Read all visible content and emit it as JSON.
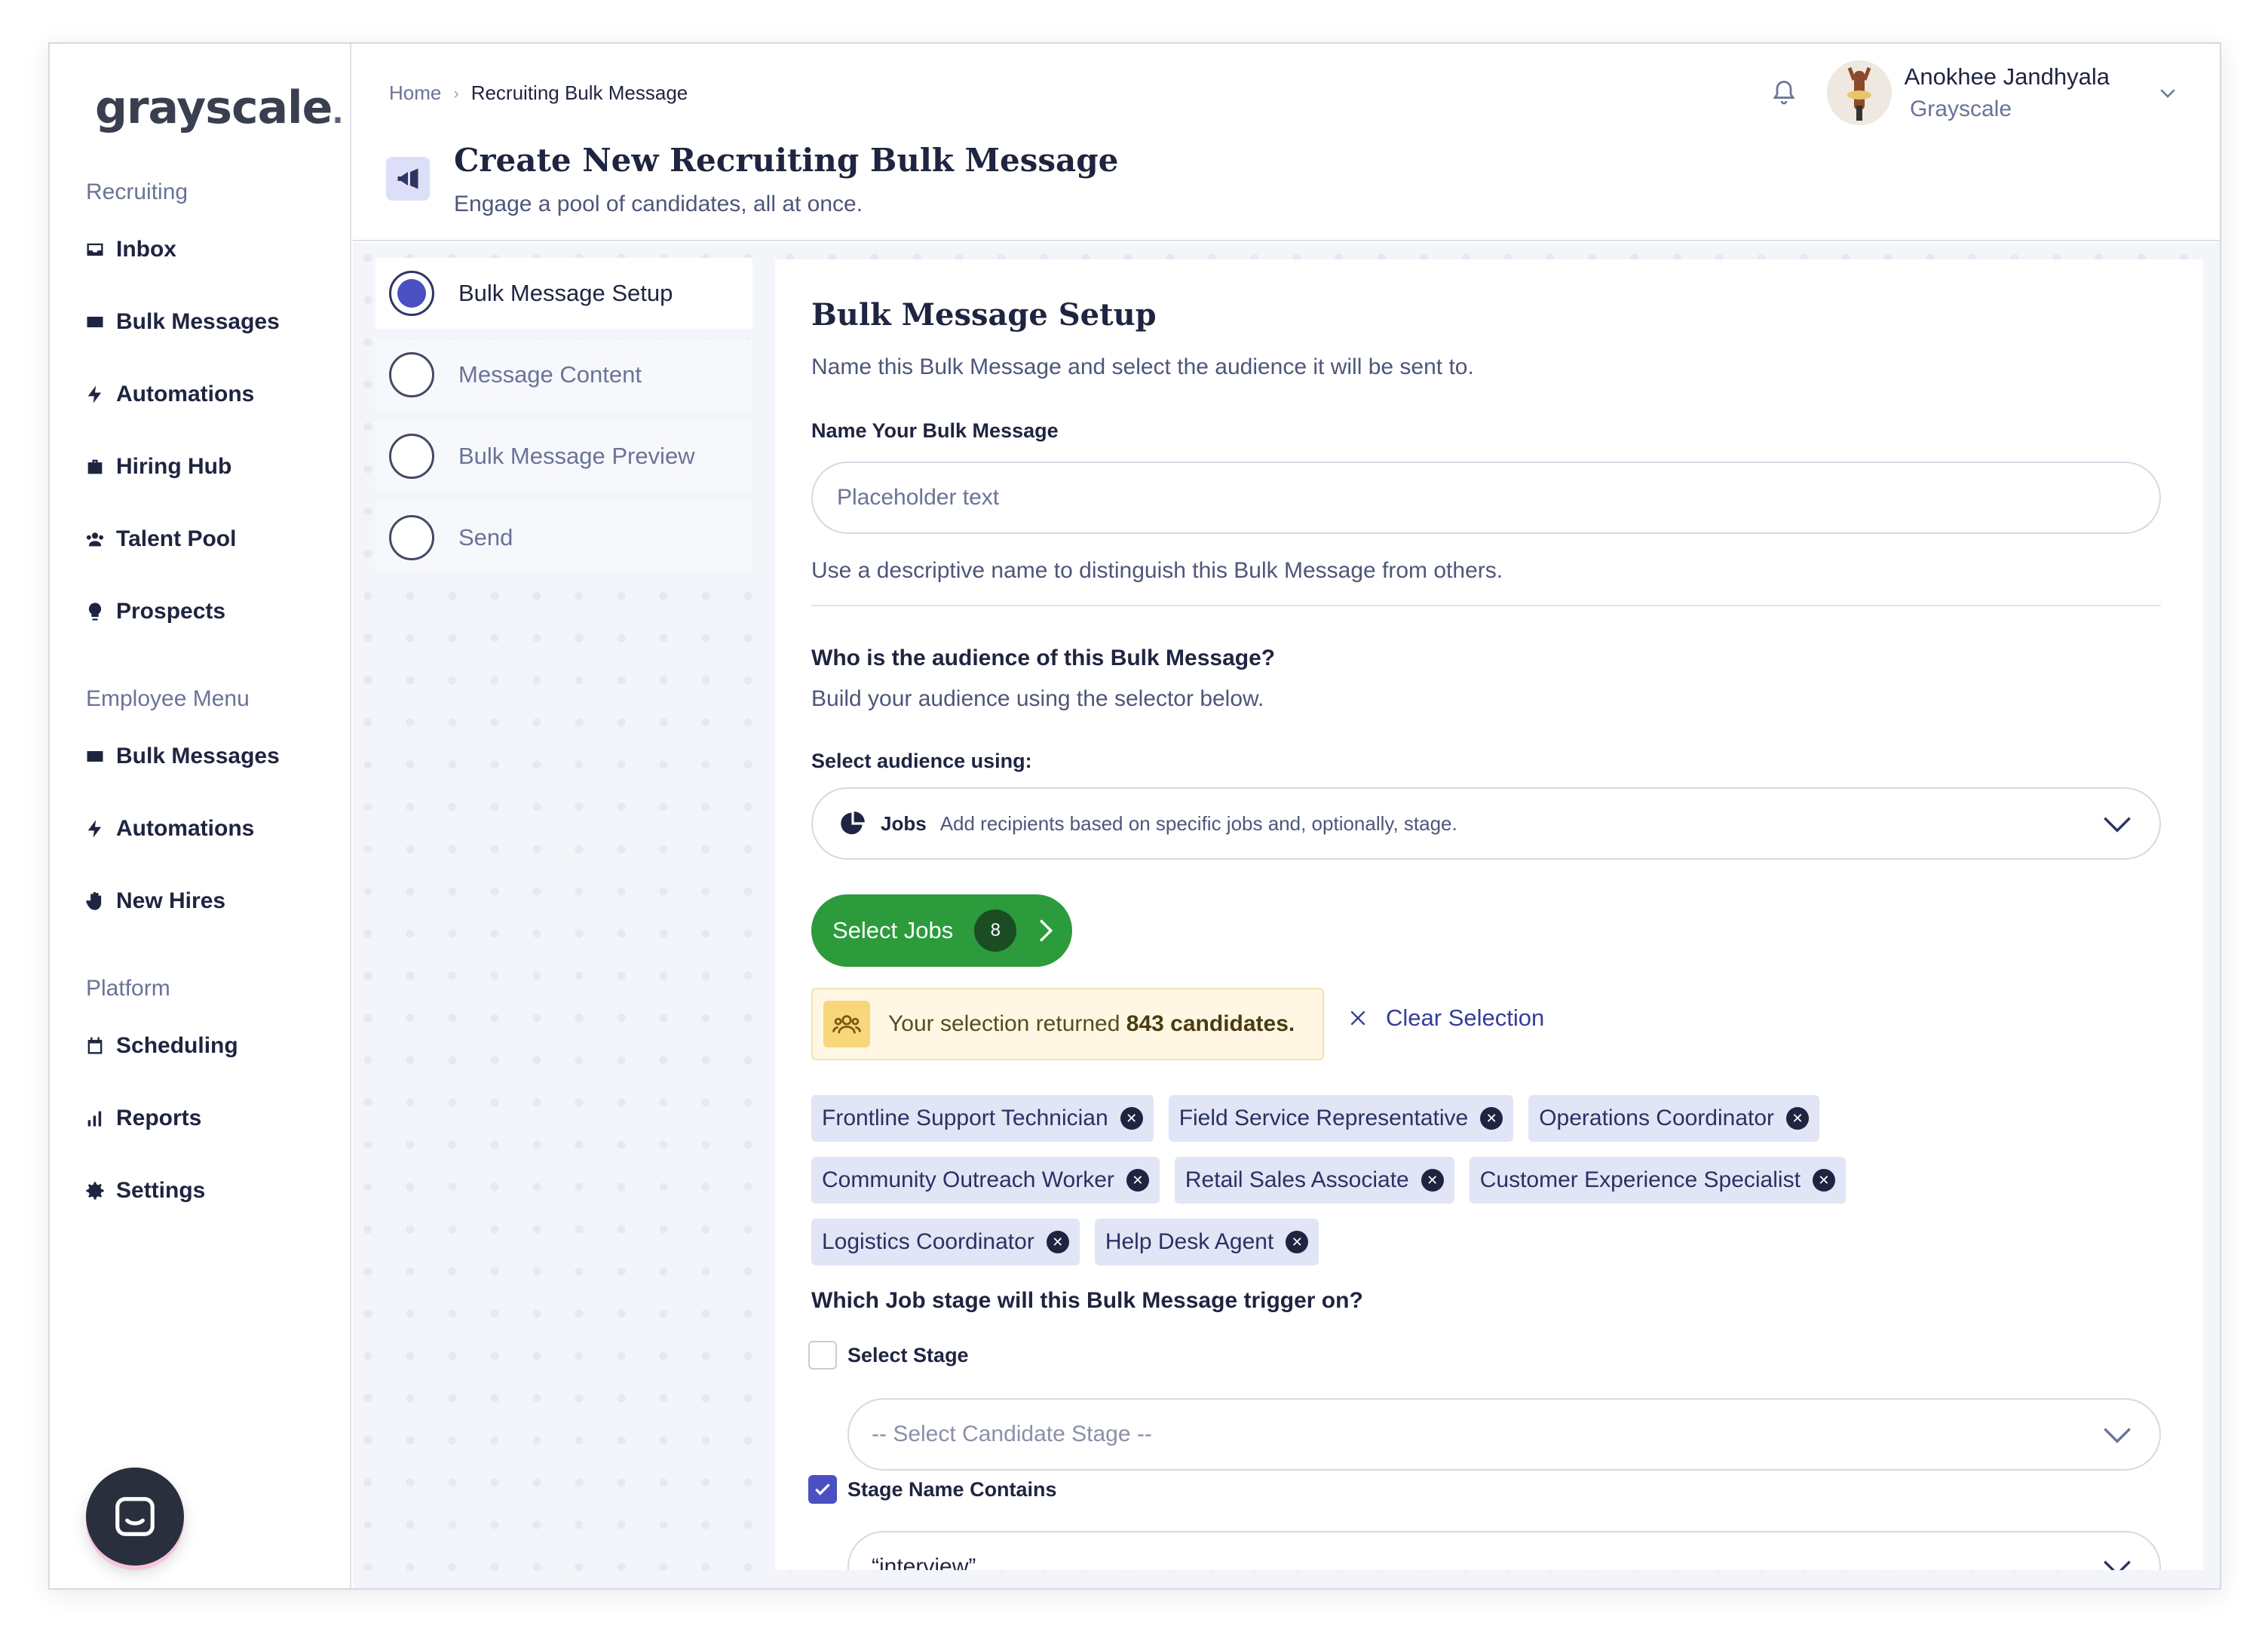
{
  "sidebar": {
    "logo": "grayscale",
    "sections": [
      {
        "title": "Recruiting",
        "items": [
          "Inbox",
          "Bulk Messages",
          "Automations",
          "Hiring Hub",
          "Talent Pool",
          "Prospects"
        ]
      },
      {
        "title": "Employee Menu",
        "items": [
          "Bulk Messages",
          "Automations",
          "New Hires"
        ]
      },
      {
        "title": "Platform",
        "items": [
          "Scheduling",
          "Reports",
          "Settings"
        ]
      }
    ]
  },
  "header": {
    "breadcrumb_home": "Home",
    "breadcrumb_current": "Recruiting Bulk Message",
    "title": "Create New Recruiting Bulk Message",
    "subtitle": "Engage a pool of candidates, all at once.",
    "user_name": "Anokhee Jandhyala",
    "user_org": "Grayscale"
  },
  "steps": [
    "Bulk Message Setup",
    "Message Content",
    "Bulk Message Preview",
    "Send"
  ],
  "panel": {
    "title": "Bulk Message Setup",
    "subtitle": "Name this Bulk Message and select the audience it will be sent to.",
    "name_label": "Name Your Bulk Message",
    "name_placeholder": "Placeholder text",
    "name_hint": "Use a descriptive name to distinguish this Bulk Message from others.",
    "audience_question": "Who is the audience of this Bulk Message?",
    "audience_sub": "Build your audience  using the selector below.",
    "select_label": "Select audience using:",
    "select_option": "Jobs",
    "select_desc": "Add recipients based on specific jobs and, optionally, stage.",
    "select_jobs_label": "Select Jobs",
    "select_jobs_count": "8",
    "result_prefix": "Your selection returned",
    "result_count": "843 candidates.",
    "clear_selection": "Clear Selection",
    "chips_rows": [
      [
        "Frontline Support Technician",
        "Field Service Representative",
        "Operations Coordinator"
      ],
      [
        "Community Outreach Worker",
        "Retail Sales Associate",
        "Customer Experience Specialist"
      ],
      [
        "Logistics Coordinator",
        "Help Desk Agent"
      ]
    ],
    "trigger_question": "Which Job stage will this Bulk Message trigger on?",
    "select_stage_label": "Select Stage",
    "stage_placeholder": "-- Select Candidate Stage --",
    "stage_contains_label": "Stage Name Contains",
    "stage_contains_value": "“interview”"
  },
  "colors": {
    "accent": "#4a4fc1",
    "green": "#2c9b3c",
    "chip_bg": "#e1e5f5",
    "notice_bg": "#fff7e3"
  }
}
